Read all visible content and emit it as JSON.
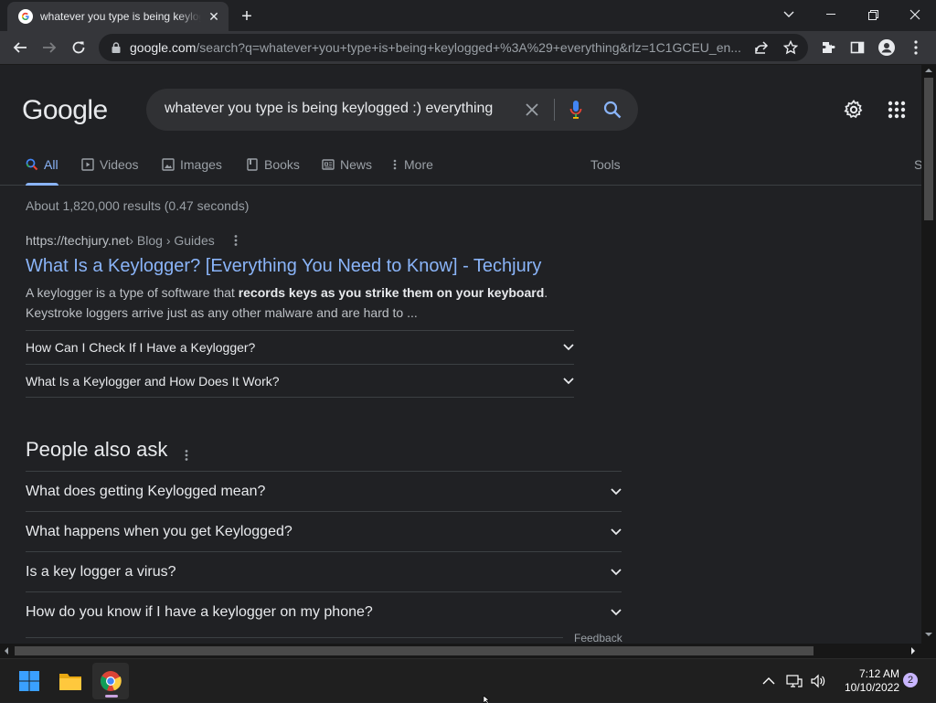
{
  "browser": {
    "tab": {
      "title": "whatever you type is being keylogged :) everything - Google Search",
      "close": "✕"
    },
    "new_tab": "+",
    "address": {
      "host": "google.com",
      "path": "/search?q=whatever+you+type+is+being+keylogged+%3A%29+everything&rlz=1C1GCEU_en..."
    }
  },
  "google": {
    "logo": "Google",
    "query": "whatever you type is being keylogged :) everything",
    "tabs": [
      {
        "label": "All",
        "icon": "search-icon"
      },
      {
        "label": "Videos",
        "icon": "video-icon"
      },
      {
        "label": "Images",
        "icon": "image-icon"
      },
      {
        "label": "Books",
        "icon": "book-icon"
      },
      {
        "label": "News",
        "icon": "news-icon"
      },
      {
        "label": "More",
        "icon": "more-vert-icon"
      }
    ],
    "tools": "Tools",
    "right_truncated": "S",
    "stats": "About 1,820,000 results (0.47 seconds)",
    "result": {
      "site": "https://techjury.net",
      "breadcrumb": " › Blog › Guides",
      "title": "What Is a Keylogger? [Everything You Need to Know] - Techjury",
      "snippet_pre": "A keylogger is a type of software that ",
      "snippet_bold": "records keys as you strike them on your keyboard",
      "snippet_post": ". Keystroke loggers arrive just as any other malware and are hard to ...",
      "faqs": [
        "How Can I Check If I Have a Keylogger?",
        "What Is a Keylogger and How Does It Work?"
      ]
    },
    "people_also_ask": {
      "title": "People also ask",
      "questions": [
        "What does getting Keylogged mean?",
        "What happens when you get Keylogged?",
        "Is a key logger a virus?",
        "How do you know if I have a keylogger on my phone?"
      ]
    },
    "feedback": "Feedback"
  },
  "taskbar": {
    "time": "7:12 AM",
    "date": "10/10/2022",
    "notifications": "2"
  },
  "colors": {
    "link": "#8ab4f8",
    "background": "#202124",
    "chrome_toolbar": "#35363a"
  }
}
